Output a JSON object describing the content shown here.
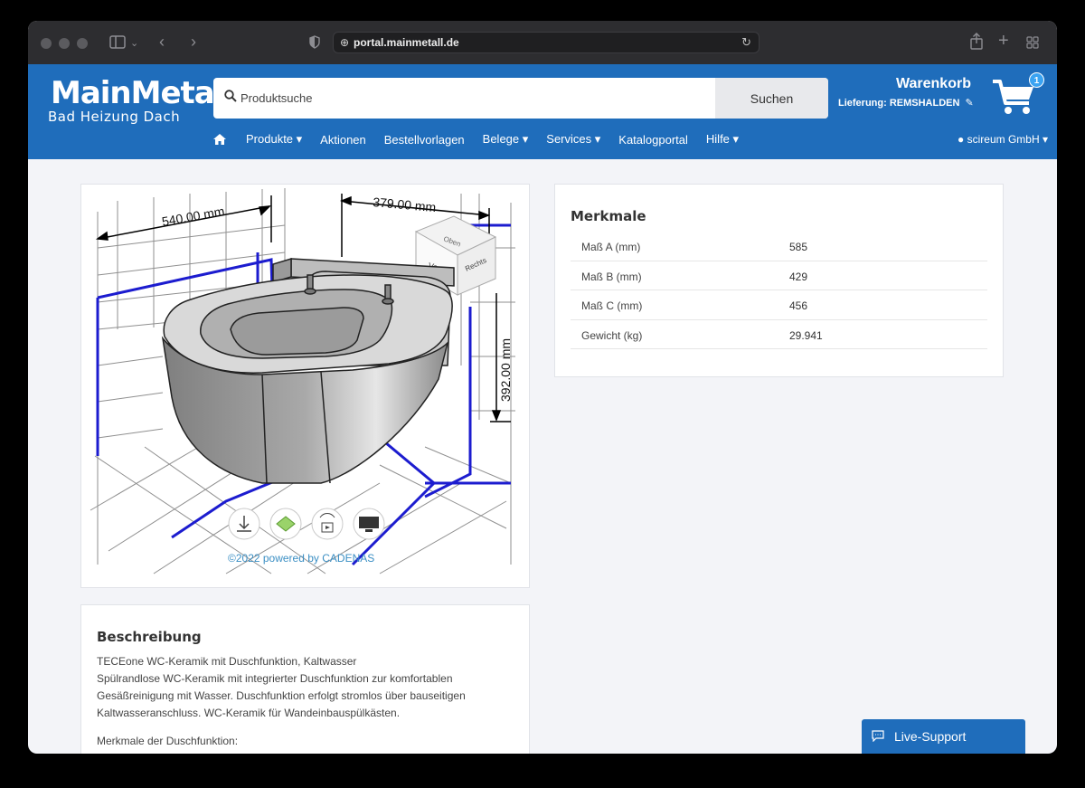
{
  "browser": {
    "url": "portal.mainmetall.de"
  },
  "header": {
    "logo_main": "MainMetall",
    "logo_sub": "Bad Heizung Dach",
    "search_placeholder": "Produktsuche",
    "search_button": "Suchen",
    "cart_title": "Warenkorb",
    "delivery": "Lieferung: REMSHALDEN",
    "cart_count": "1",
    "user": "scireum GmbH"
  },
  "nav": {
    "items": [
      {
        "label": "Produkte ▾"
      },
      {
        "label": "Aktionen"
      },
      {
        "label": "Bestellvorlagen"
      },
      {
        "label": "Belege ▾"
      },
      {
        "label": "Services ▾"
      },
      {
        "label": "Katalogportal"
      },
      {
        "label": "Hilfe ▾"
      }
    ]
  },
  "viewer": {
    "dim_a": "540.00 mm",
    "dim_b": "379.00 mm",
    "dim_c": "392.00 mm",
    "cube_top": "Oben",
    "cube_front": "Vorn",
    "cube_right": "Rechts",
    "powered_by": "©2022 powered by CADENAS"
  },
  "merkmale": {
    "title": "Merkmale",
    "rows": [
      {
        "label": "Maß A (mm)",
        "value": "585"
      },
      {
        "label": "Maß B (mm)",
        "value": "429"
      },
      {
        "label": "Maß C (mm)",
        "value": "456"
      },
      {
        "label": "Gewicht (kg)",
        "value": "29.941"
      }
    ]
  },
  "beschreibung": {
    "title": "Beschreibung",
    "line1": "TECEone WC-Keramik mit Duschfunktion, Kaltwasser",
    "line2": "Spülrandlose WC-Keramik mit integrierter Duschfunktion zur komfortablen",
    "line3": "Gesäßreinigung mit Wasser. Duschfunktion erfolgt stromlos über bauseitigen",
    "line4": "Kaltwasseranschluss. WC-Keramik für Wandeinbauspülkästen.",
    "subheading": "Merkmale der Duschfunktion:"
  },
  "support": {
    "label": "Live-Support"
  },
  "colors": {
    "brand_blue": "#1f6dbb",
    "badge_blue": "#3aa3f2",
    "link_blue": "#3b8fc4"
  }
}
